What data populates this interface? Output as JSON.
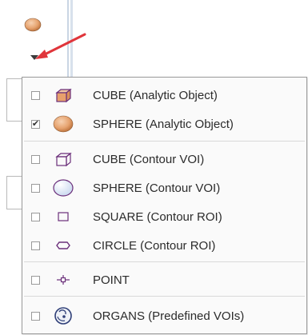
{
  "toolbar": {
    "sphere_icon": "sphere-object-icon",
    "dropdown_icon": "dropdown-arrow-icon",
    "annotation": "red-arrow-annotation",
    "colors": {
      "sphere": "#e6a36f",
      "arrow": "#e0353b"
    }
  },
  "menu": {
    "items": [
      {
        "label": "CUBE (Analytic Object)",
        "checked": false,
        "icon": "cube-solid-icon"
      },
      {
        "label": "SPHERE (Analytic Object)",
        "checked": true,
        "check_mark": "✔",
        "icon": "sphere-solid-icon"
      },
      {
        "label": "CUBE (Contour VOI)",
        "checked": false,
        "icon": "cube-outline-icon"
      },
      {
        "label": "SPHERE (Contour VOI)",
        "checked": false,
        "icon": "sphere-outline-icon"
      },
      {
        "label": "SQUARE (Contour ROI)",
        "checked": false,
        "icon": "square-outline-icon"
      },
      {
        "label": "CIRCLE (Contour ROI)",
        "checked": false,
        "icon": "circle-outline-icon"
      },
      {
        "label": "POINT",
        "checked": false,
        "icon": "point-icon"
      },
      {
        "label": "ORGANS (Predefined VOIs)",
        "checked": false,
        "icon": "organs-icon"
      }
    ],
    "colors": {
      "object_fill": "#e8a06c",
      "outline": "#6b2f7a"
    }
  }
}
